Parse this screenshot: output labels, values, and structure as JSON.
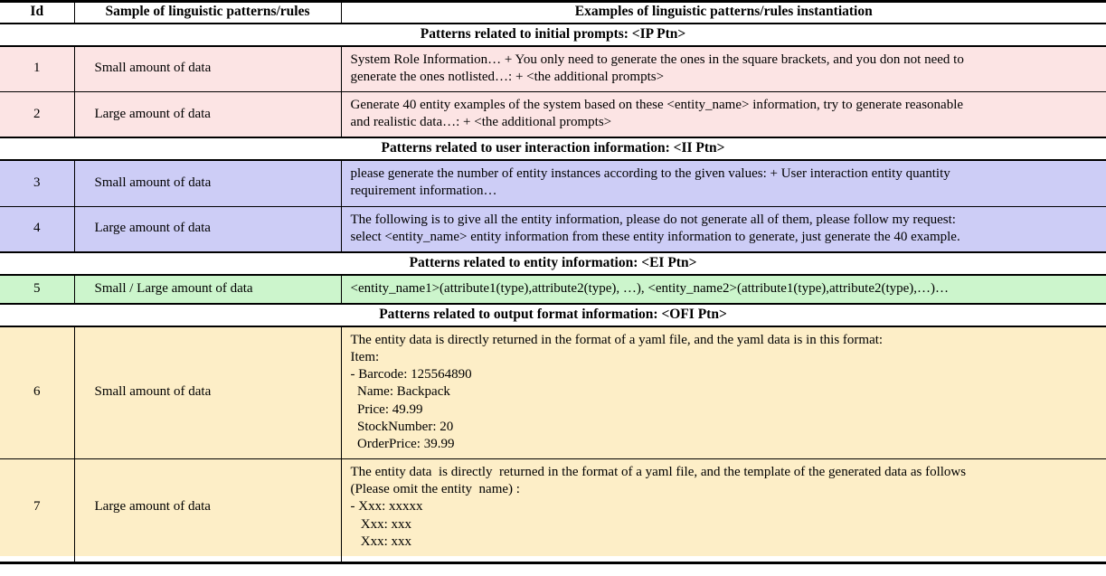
{
  "table": {
    "columns": [
      {
        "key": "id",
        "label": "Id"
      },
      {
        "key": "sample",
        "label": "Sample of linguistic patterns/rules"
      },
      {
        "key": "example",
        "label": "Examples of linguistic patterns/rules instantiation"
      }
    ],
    "colors": {
      "initial_prompts": "#fce4e4",
      "user_interaction": "#cdcdf6",
      "entity_information": "#ccf5cc",
      "output_format": "#fdeec7",
      "border": "#000000",
      "background": "#ffffff"
    },
    "sections": [
      {
        "banner": "Patterns related to initial prompts: <IP Ptn>",
        "tint": "tint-pink",
        "rows": [
          {
            "id": "1",
            "sample": "Small amount of data",
            "example_lines": [
              "System Role Information… + You only need to generate the ones in the square brackets, and you don not need to",
              "generate the ones notlisted…: + <the additional prompts>"
            ]
          },
          {
            "id": "2",
            "sample": "Large amount of data",
            "example_lines": [
              "Generate 40 entity examples of the system based on these <entity_name> information, try to generate reasonable",
              "and realistic data…: + <the additional prompts>"
            ]
          }
        ]
      },
      {
        "banner": "Patterns related to user interaction information: <II Ptn>",
        "tint": "tint-blue",
        "rows": [
          {
            "id": "3",
            "sample": "Small amount of data",
            "example_lines": [
              "please generate the number of entity instances according to the given values: + User interaction entity quantity",
              "requirement information…"
            ]
          },
          {
            "id": "4",
            "sample": "Large amount of data",
            "example_lines": [
              "The following is to give all the entity information, please do not generate all of them, please follow my request:",
              "select <entity_name> entity information from these entity information to generate, just generate the 40 example."
            ]
          }
        ]
      },
      {
        "banner": "Patterns related to entity information: <EI Ptn>",
        "tint": "tint-green",
        "rows": [
          {
            "id": "5",
            "sample": "Small / Large amount of data",
            "example_lines": [
              "<entity_name1>(attribute1(type),attribute2(type), …), <entity_name2>(attribute1(type),attribute2(type),…)…"
            ]
          }
        ]
      },
      {
        "banner": "Patterns related to output format information: <OFI Ptn>",
        "tint": "tint-yellow",
        "rows": [
          {
            "id": "6",
            "sample": "Small amount of data",
            "example_lines": [
              "The entity data is directly returned in the format of a yaml file, and the yaml data is in this format:",
              "Item:",
              "- Barcode: 125564890",
              "  Name: Backpack",
              "  Price: 49.99",
              "  StockNumber: 20",
              "  OrderPrice: 39.99"
            ]
          },
          {
            "id": "7",
            "sample": "Large amount of data",
            "example_lines": [
              "The entity data  is directly  returned in the format of a yaml file, and the template of the generated data as follows",
              "(Please omit the entity  name) :",
              "- Xxx: xxxxx",
              "   Xxx: xxx",
              "   Xxx: xxx"
            ]
          }
        ]
      }
    ]
  }
}
